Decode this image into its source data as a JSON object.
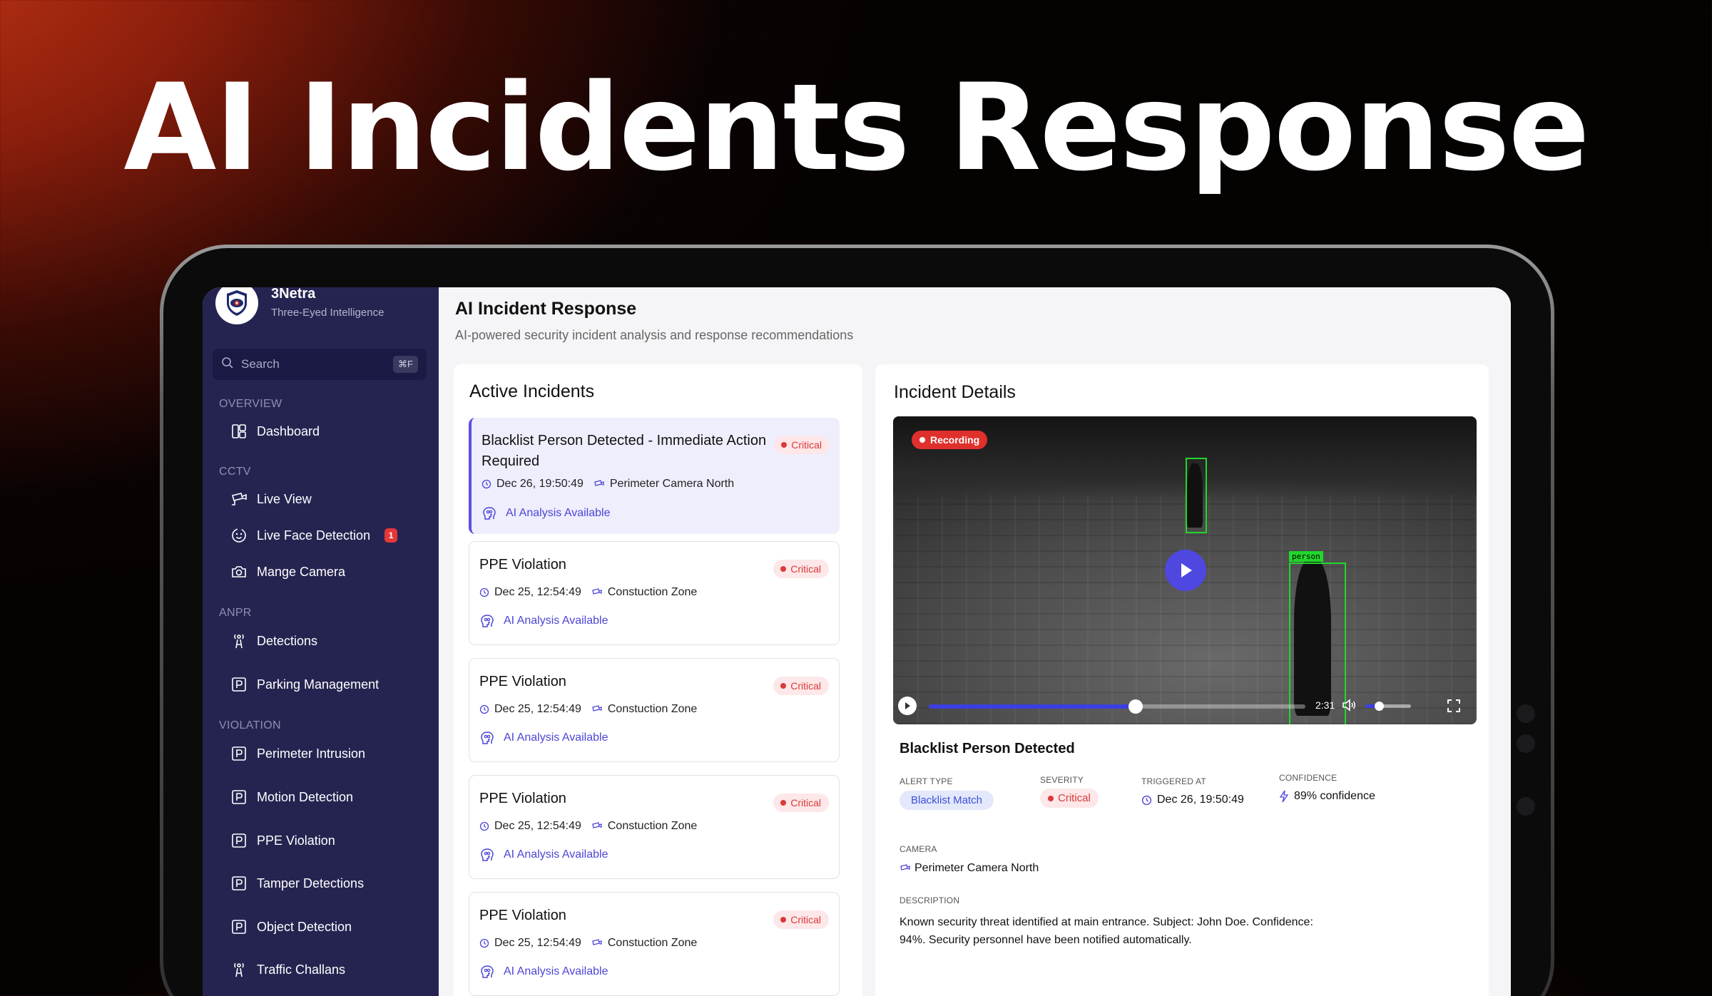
{
  "hero": {
    "title": "AI Incidents Response"
  },
  "brand": {
    "name": "3Netra",
    "tagline": "Three-Eyed Intelligence"
  },
  "search": {
    "placeholder": "Search",
    "shortcut": "⌘F"
  },
  "sidebar": {
    "sections": [
      {
        "label": "OVERVIEW",
        "items": [
          {
            "label": "Dashboard",
            "icon": "dashboard-icon"
          }
        ]
      },
      {
        "label": "CCTV",
        "items": [
          {
            "label": "Live View",
            "icon": "video-camera-icon"
          },
          {
            "label": "Live Face Detection",
            "icon": "face-scan-icon",
            "badge": "1"
          },
          {
            "label": "Mange Camera",
            "icon": "camera-settings-icon"
          }
        ]
      },
      {
        "label": "ANPR",
        "items": [
          {
            "label": "Detections",
            "icon": "antenna-icon"
          },
          {
            "label": "Parking Management",
            "icon": "parking-icon"
          }
        ]
      },
      {
        "label": "VIOLATION",
        "items": [
          {
            "label": "Perimeter Intrusion",
            "icon": "parking-icon"
          },
          {
            "label": "Motion Detection",
            "icon": "parking-icon"
          },
          {
            "label": "PPE Violation",
            "icon": "parking-icon"
          },
          {
            "label": "Tamper Detections",
            "icon": "parking-icon"
          },
          {
            "label": "Object Detection",
            "icon": "parking-icon"
          },
          {
            "label": "Traffic Challans",
            "icon": "antenna-icon"
          }
        ]
      }
    ]
  },
  "page": {
    "title": "AI Incident Response",
    "subtitle": "AI-powered security incident analysis and response recommendations"
  },
  "incidents": {
    "title": "Active Incidents",
    "items": [
      {
        "title": "Blacklist Person Detected - Immediate Action Required",
        "severity": "Critical",
        "time": "Dec 26, 19:50:49",
        "location": "Perimeter Camera North",
        "ai": "AI Analysis Available",
        "active": true
      },
      {
        "title": "PPE Violation",
        "severity": "Critical",
        "time": "Dec 25, 12:54:49",
        "location": "Constuction Zone",
        "ai": "AI Analysis Available"
      },
      {
        "title": "PPE Violation",
        "severity": "Critical",
        "time": "Dec 25, 12:54:49",
        "location": "Constuction Zone",
        "ai": "AI Analysis Available"
      },
      {
        "title": "PPE Violation",
        "severity": "Critical",
        "time": "Dec 25, 12:54:49",
        "location": "Constuction Zone",
        "ai": "AI Analysis Available"
      },
      {
        "title": "PPE Violation",
        "severity": "Critical",
        "time": "Dec 25, 12:54:49",
        "location": "Constuction Zone",
        "ai": "AI Analysis Available"
      }
    ]
  },
  "details": {
    "title": "Incident Details",
    "video": {
      "recording_label": "Recording",
      "time": "2:31",
      "progress": 0.55,
      "volume": 0.3,
      "box_label": "person"
    },
    "heading": "Blacklist Person Detected",
    "alert_type_label": "ALERT TYPE",
    "alert_type": "Blacklist Match",
    "severity_label": "SEVERITY",
    "severity": "Critical",
    "triggered_label": "TRIGGERED AT",
    "triggered": "Dec 26, 19:50:49",
    "confidence_label": "CONFIDENCE",
    "confidence": "89% confidence",
    "camera_label": "CAMERA",
    "camera": "Perimeter Camera North",
    "description_label": "DESCRIPTION",
    "description": "Known security threat identified at main entrance. Subject: John Doe. Confidence: 94%. Security personnel have been notified automatically."
  },
  "colors": {
    "accent": "#4e47e0",
    "critical": "#d93a3a",
    "sidebar": "#252451"
  }
}
